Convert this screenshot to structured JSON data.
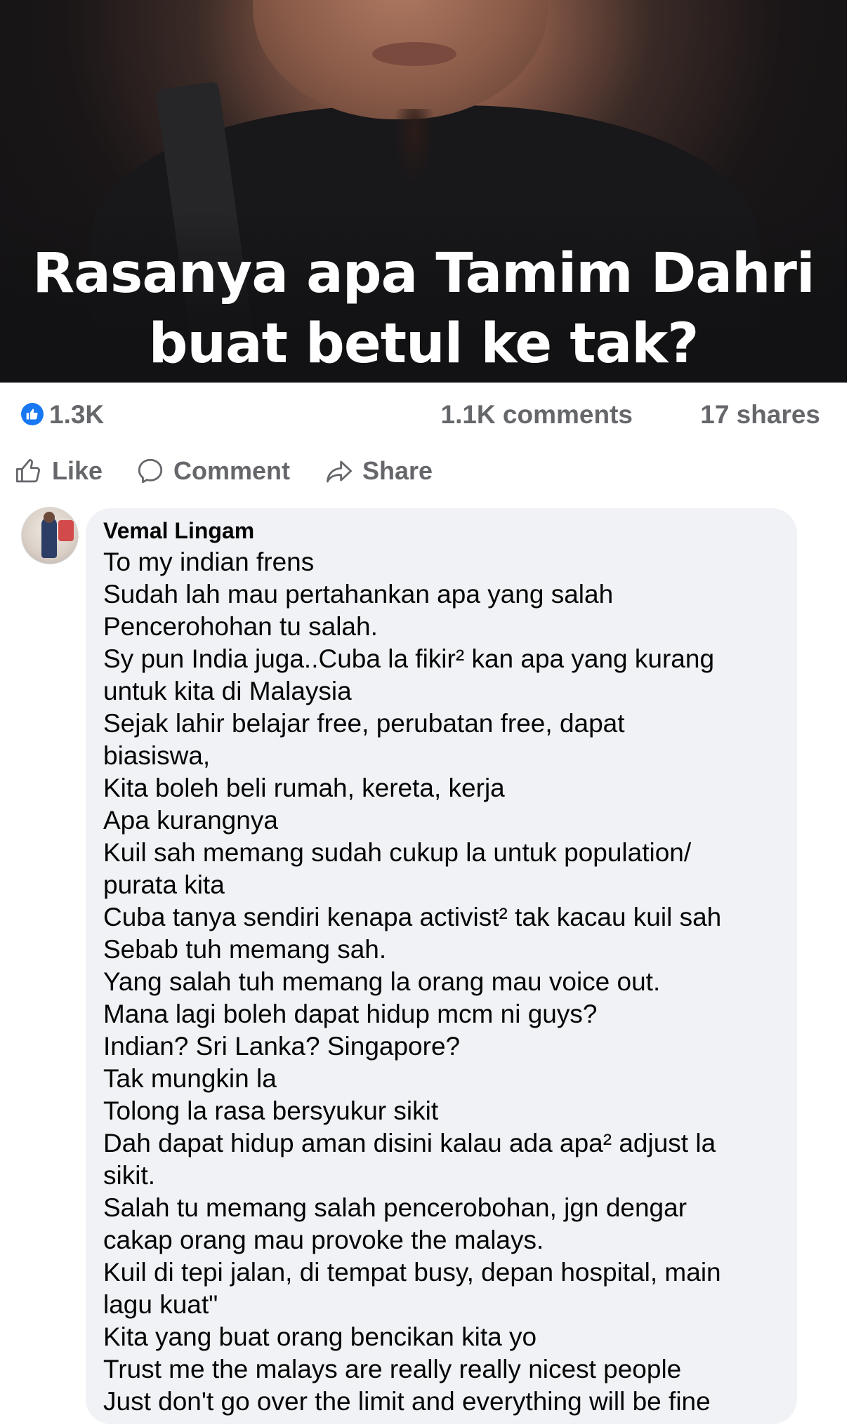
{
  "post": {
    "image_caption_line1": "Rasanya apa Tamim Dahri",
    "image_caption_line2": "buat betul ke tak?"
  },
  "stats": {
    "reactions": "1.3K",
    "comments": "1.1K comments",
    "shares": "17 shares"
  },
  "actions": {
    "like": "Like",
    "comment": "Comment",
    "share": "Share"
  },
  "comment": {
    "author": "Vemal Lingam",
    "lines": [
      "To my indian frens",
      "Sudah lah mau pertahankan apa yang salah",
      "Pencerohohan tu salah.",
      "Sy pun India juga..Cuba la fikir² kan apa yang kurang",
      "untuk kita di Malaysia",
      "Sejak lahir belajar free, perubatan free, dapat",
      "biasiswa,",
      "Kita boleh beli rumah, kereta, kerja",
      "Apa kurangnya",
      "Kuil sah memang sudah cukup la untuk population/",
      "purata kita",
      "Cuba tanya sendiri kenapa activist² tak kacau kuil sah",
      "Sebab tuh memang sah.",
      "Yang salah tuh memang la orang mau voice out.",
      "Mana lagi boleh dapat hidup mcm ni guys?",
      "Indian? Sri Lanka? Singapore?",
      "Tak mungkin la",
      "Tolong la rasa bersyukur sikit",
      "Dah dapat hidup aman disini kalau ada apa² adjust la",
      "sikit.",
      "Salah tu memang salah pencerobohan, jgn dengar",
      "cakap orang mau provoke the malays.",
      "Kuil di tepi jalan, di tempat busy, depan hospital, main",
      "lagu kuat\"",
      "Kita yang buat orang bencikan kita yo",
      "Trust me the malays are really really nicest people",
      "Just don't go over the limit and everything will be fine"
    ]
  },
  "colors": {
    "brand_blue": "#1877f2",
    "muted_text": "#65676b",
    "bubble_bg": "#f0f2f5"
  },
  "icons": [
    "thumbs-up-icon",
    "like-outline-icon",
    "comment-icon",
    "share-icon"
  ]
}
